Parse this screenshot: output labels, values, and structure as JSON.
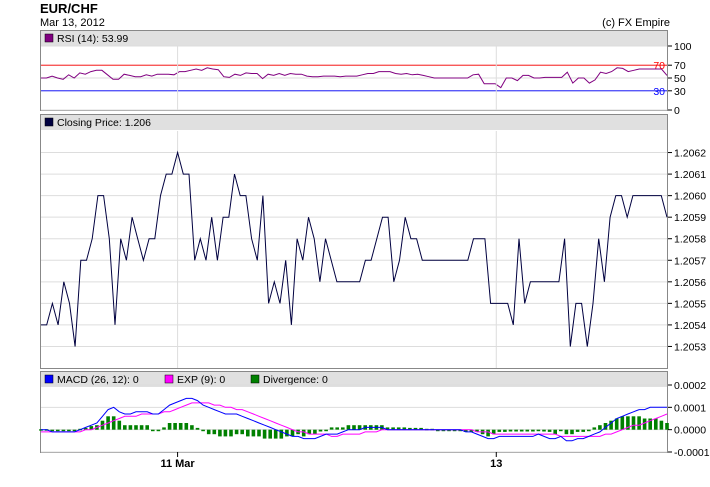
{
  "header": {
    "symbol": "EUR/CHF",
    "date": "Mar 13, 2012",
    "credit": "(c) FX Empire"
  },
  "colors": {
    "rsi": "#800080",
    "price": "#000040",
    "macd": "#0000ff",
    "exp": "#ff00ff",
    "divergence": "#008000",
    "upper_level": "#ff0000",
    "lower_level": "#0000ff",
    "panel_header": "#e0e0e0",
    "grid": "#dddddd"
  },
  "chart_data": [
    {
      "type": "line",
      "panel": "rsi",
      "legend": "RSI (14): 53.99",
      "ylim": [
        0,
        100
      ],
      "yticks": [
        "0",
        "30",
        "50",
        "70",
        "100"
      ],
      "reference_lines": [
        {
          "label": "70",
          "value": 70,
          "color": "#ff0000"
        },
        {
          "label": "30",
          "value": 30,
          "color": "#0000ff"
        }
      ],
      "values": [
        50,
        50,
        53,
        50,
        48,
        55,
        50,
        58,
        56,
        60,
        62,
        62,
        55,
        48,
        48,
        56,
        54,
        52,
        52,
        55,
        53,
        56,
        56,
        56,
        55,
        60,
        60,
        62,
        64,
        62,
        66,
        64,
        63,
        52,
        51,
        56,
        54,
        58,
        57,
        57,
        49,
        56,
        54,
        57,
        54,
        57,
        56,
        56,
        53,
        52,
        52,
        53,
        53,
        53,
        52,
        53,
        53,
        53,
        55,
        57,
        57,
        60,
        60,
        60,
        57,
        56,
        57,
        55,
        56,
        54,
        52,
        50,
        50,
        50,
        50,
        50,
        50,
        50,
        55,
        56,
        41,
        41,
        41,
        35,
        50,
        50,
        46,
        54,
        54,
        50,
        50,
        51,
        51,
        51,
        51,
        59,
        42,
        50,
        50,
        42,
        47,
        59,
        57,
        60,
        66,
        65,
        60,
        62,
        64,
        64,
        64,
        64,
        64,
        54
      ]
    },
    {
      "type": "line",
      "panel": "price",
      "legend": "Closing Price: 1.206",
      "ylim": [
        1.2052,
        1.2063
      ],
      "yticks": [
        "1.2053",
        "1.2054",
        "1.2055",
        "1.2056",
        "1.2057",
        "1.2058",
        "1.2059",
        "1.2060",
        "1.2061",
        "1.2062"
      ],
      "values": [
        1.2054,
        1.2054,
        1.2055,
        1.2054,
        1.2056,
        1.2055,
        1.2053,
        1.2057,
        1.2057,
        1.2058,
        1.206,
        1.206,
        1.2058,
        1.2054,
        1.2058,
        1.2057,
        1.2059,
        1.2058,
        1.2057,
        1.2058,
        1.2058,
        1.206,
        1.2061,
        1.2061,
        1.2062,
        1.2061,
        1.2061,
        1.2057,
        1.2058,
        1.2057,
        1.2059,
        1.2057,
        1.2059,
        1.2059,
        1.2061,
        1.206,
        1.206,
        1.2058,
        1.2057,
        1.206,
        1.2055,
        1.2056,
        1.2055,
        1.2057,
        1.2054,
        1.2058,
        1.2057,
        1.2059,
        1.2058,
        1.2056,
        1.2058,
        1.2057,
        1.2056,
        1.2056,
        1.2056,
        1.2056,
        1.2056,
        1.2057,
        1.2057,
        1.2058,
        1.2059,
        1.2059,
        1.2056,
        1.2057,
        1.2059,
        1.2058,
        1.2058,
        1.2057,
        1.2057,
        1.2057,
        1.2057,
        1.2057,
        1.2057,
        1.2057,
        1.2057,
        1.2057,
        1.2058,
        1.2058,
        1.2058,
        1.2055,
        1.2055,
        1.2055,
        1.2055,
        1.2054,
        1.2058,
        1.2055,
        1.2056,
        1.2056,
        1.2056,
        1.2056,
        1.2056,
        1.2056,
        1.2058,
        1.2053,
        1.2055,
        1.2055,
        1.2053,
        1.2055,
        1.2058,
        1.2056,
        1.2059,
        1.206,
        1.206,
        1.2059,
        1.206,
        1.206,
        1.206,
        1.206,
        1.206,
        1.206,
        1.2059
      ]
    },
    {
      "type": "line",
      "panel": "macd",
      "legend": [
        {
          "label": "MACD (26, 12): 0",
          "color": "#0000ff"
        },
        {
          "label": "EXP (9): 0",
          "color": "#ff00ff"
        },
        {
          "label": "Divergence: 0",
          "color": "#008000"
        }
      ],
      "ylim": [
        -0.0001,
        0.0002
      ],
      "yticks": [
        "-0.0001",
        "0.0000",
        "0.0001",
        "0.0002"
      ],
      "x_tick_labels": [
        {
          "label": "11 Mar",
          "index": 24
        },
        {
          "label": "13",
          "index": 80
        }
      ],
      "series": [
        {
          "name": "MACD (26, 12): 0",
          "values": [
            0.0,
            0.0,
            -1e-05,
            -1e-05,
            -1e-05,
            -1e-05,
            -1e-05,
            0.0,
            1e-05,
            2e-05,
            3e-05,
            6e-05,
            9e-05,
            0.0001,
            8e-05,
            7e-05,
            7e-05,
            8e-05,
            8e-05,
            8e-05,
            7e-05,
            7e-05,
            9e-05,
            0.00011,
            0.00012,
            0.00013,
            0.00014,
            0.00014,
            0.00013,
            0.00011,
            0.0001,
            9e-05,
            8e-05,
            7e-05,
            7e-05,
            7e-05,
            6e-05,
            5e-05,
            4e-05,
            3e-05,
            2e-05,
            1e-05,
            0.0,
            -1e-05,
            -2e-05,
            -3e-05,
            -3e-05,
            -4e-05,
            -4e-05,
            -4e-05,
            -3e-05,
            -2e-05,
            -2e-05,
            -2e-05,
            -1e-05,
            0.0,
            0.0,
            0.0,
            1e-05,
            1e-05,
            1e-05,
            1e-05,
            0.0,
            0.0,
            0.0,
            0.0,
            0.0,
            0.0,
            0.0,
            0.0,
            0.0,
            0.0,
            0.0,
            0.0,
            0.0,
            0.0,
            -1e-05,
            -1e-05,
            -2e-05,
            -3e-05,
            -4e-05,
            -4e-05,
            -3e-05,
            -3e-05,
            -3e-05,
            -3e-05,
            -3e-05,
            -3e-05,
            -3e-05,
            -2e-05,
            -3e-05,
            -4e-05,
            -4e-05,
            -3e-05,
            -5e-05,
            -5e-05,
            -4e-05,
            -4e-05,
            -3e-05,
            -2e-05,
            -1e-05,
            1e-05,
            3e-05,
            5e-05,
            6e-05,
            7e-05,
            8e-05,
            9e-05,
            9e-05,
            0.0001,
            0.0001,
            0.0001,
            0.0001
          ]
        },
        {
          "name": "EXP (9): 0",
          "values": [
            -1e-05,
            -1e-05,
            -1e-05,
            -1e-05,
            -1e-05,
            -1e-05,
            -1e-05,
            -1e-05,
            0.0,
            0.0,
            1e-05,
            2e-05,
            3e-05,
            4e-05,
            5e-05,
            6e-05,
            6e-05,
            6e-05,
            7e-05,
            7e-05,
            7e-05,
            7e-05,
            8e-05,
            8e-05,
            9e-05,
            0.0001,
            0.00011,
            0.00012,
            0.00012,
            0.00012,
            0.00012,
            0.00011,
            0.00011,
            0.0001,
            0.0001,
            9e-05,
            9e-05,
            8e-05,
            7e-05,
            6e-05,
            5e-05,
            4e-05,
            3e-05,
            2e-05,
            1e-05,
            0.0,
            -1e-05,
            -1e-05,
            -2e-05,
            -2e-05,
            -2e-05,
            -2e-05,
            -3e-05,
            -3e-05,
            -2e-05,
            -2e-05,
            -2e-05,
            -2e-05,
            -1e-05,
            -1e-05,
            -1e-05,
            0.0,
            0.0,
            0.0,
            0.0,
            0.0,
            0.0,
            0.0,
            0.0,
            0.0,
            0.0,
            0.0,
            0.0,
            0.0,
            0.0,
            0.0,
            0.0,
            0.0,
            -1e-05,
            -1e-05,
            -1e-05,
            -2e-05,
            -2e-05,
            -2e-05,
            -2e-05,
            -2e-05,
            -2e-05,
            -2e-05,
            -2e-05,
            -2e-05,
            -2e-05,
            -2e-05,
            -2e-05,
            -3e-05,
            -3e-05,
            -3e-05,
            -3e-05,
            -3e-05,
            -3e-05,
            -3e-05,
            -3e-05,
            -2e-05,
            -2e-05,
            -1e-05,
            0.0,
            1e-05,
            2e-05,
            2e-05,
            3e-05,
            4e-05,
            5e-05,
            6e-05,
            7e-05
          ]
        },
        {
          "name": "Divergence: 0",
          "values": [
            2e-06,
            2e-06,
            0.0,
            -2e-06,
            -2e-06,
            -2e-06,
            -2e-06,
            4e-06,
            8e-06,
            1.6e-05,
            2e-05,
            4e-05,
            6e-05,
            6e-05,
            4e-05,
            2e-05,
            2e-05,
            2e-05,
            2e-05,
            2e-05,
            0.0,
            0.0,
            1e-05,
            3e-05,
            3e-05,
            3e-05,
            3e-05,
            2e-05,
            8e-06,
            -4e-06,
            -2e-05,
            -2e-05,
            -3e-05,
            -3e-05,
            -3e-05,
            -2e-05,
            -2e-05,
            -3e-05,
            -3e-05,
            -3e-05,
            -4e-05,
            -4e-05,
            -4e-05,
            -4e-05,
            -3e-05,
            -3e-05,
            -2e-05,
            -3e-05,
            -2e-05,
            -2e-05,
            -8e-06,
            0.0,
            1e-05,
            1e-05,
            1e-05,
            2e-05,
            2e-05,
            2e-05,
            2e-05,
            2e-05,
            2e-05,
            2e-05,
            1e-05,
            1e-05,
            1e-05,
            1e-05,
            8e-06,
            8e-06,
            8e-06,
            4e-06,
            4e-06,
            0.0,
            0.0,
            0.0,
            0.0,
            0.0,
            -1e-05,
            -1e-05,
            -1e-05,
            -2e-05,
            -3e-05,
            -2e-05,
            -1e-05,
            -1e-05,
            -8e-06,
            -8e-06,
            -8e-06,
            -8e-06,
            -8e-06,
            0.0,
            -8e-06,
            -1e-05,
            -2e-05,
            0.0,
            -2e-05,
            -2e-05,
            -1e-05,
            -1e-05,
            0.0,
            1e-05,
            2e-05,
            3e-05,
            4e-05,
            5e-05,
            6e-05,
            6e-05,
            6e-05,
            6e-05,
            5e-05,
            5e-05,
            5e-05,
            4e-05,
            3e-05
          ]
        }
      ]
    }
  ]
}
